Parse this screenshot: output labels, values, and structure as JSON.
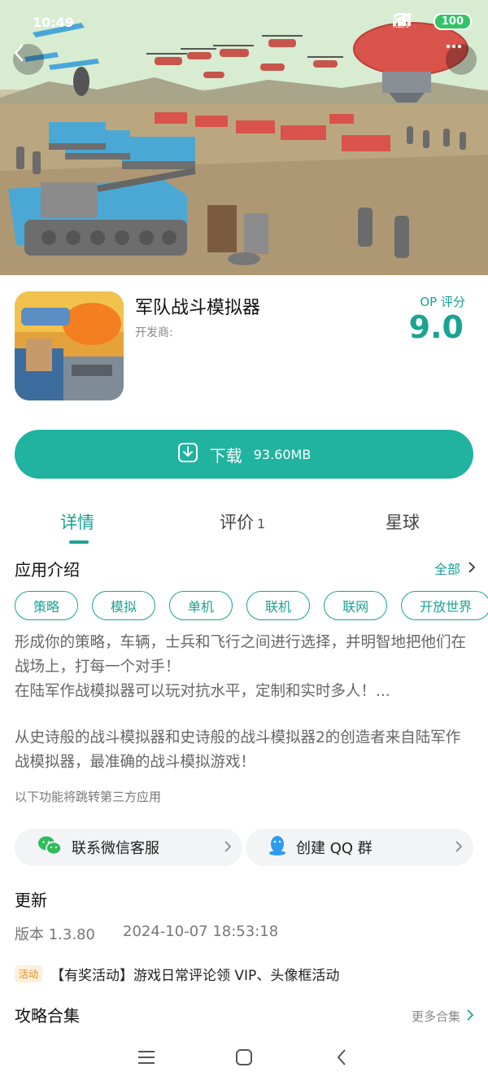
{
  "status_bar": {
    "time": "10:49",
    "net_speed": "1.35\nKB/s",
    "battery": "100"
  },
  "app": {
    "name": "军队战斗模拟器",
    "developer_label": "开发商:",
    "score_label": "OP 评分",
    "score_value": "9.0"
  },
  "download": {
    "label": "下载",
    "size": "93.60MB"
  },
  "tabs": [
    {
      "label": "详情",
      "active": true
    },
    {
      "label": "评价",
      "count": "1"
    },
    {
      "label": "星球"
    }
  ],
  "intro": {
    "title": "应用介绍",
    "all_link": "全部",
    "tags": [
      "策略",
      "模拟",
      "单机",
      "联机",
      "联网",
      "开放世界"
    ],
    "desc_1": "形成你的策略，车辆，士兵和飞行之间进行选择，并明智地把他们在战场上，打每一个对手！\n在陆军作战模拟器可以玩对抗水平，定制和实时多人！...",
    "desc_2": "从史诗般的战斗模拟器和史诗般的战斗模拟器2的创造者来自陆军作战模拟器，最准确的战斗模拟游戏！",
    "third_party_note": "以下功能将跳转第三方应用"
  },
  "service": {
    "wechat_label": "联系微信客服",
    "qq_label": "创建 QQ 群"
  },
  "update": {
    "title": "更新",
    "version": "版本 1.3.80",
    "date": "2024-10-07 18:53:18"
  },
  "activity": {
    "badge": "活动",
    "text": "【有奖活动】游戏日常评论领 VIP、头像框活动"
  },
  "guides": {
    "title": "攻略合集",
    "more_link": "更多合集"
  },
  "colors": {
    "accent": "#1aa392",
    "download_bg": "#1fb3a0"
  }
}
